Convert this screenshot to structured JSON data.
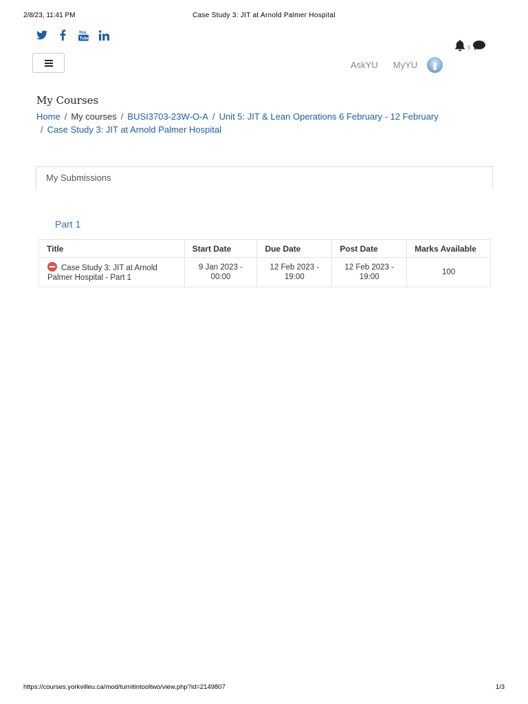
{
  "print_header": {
    "datetime": "2/8/23, 11:41 PM",
    "title": "Case Study 3: JIT at Arnold Palmer Hospital"
  },
  "social_icons": [
    "twitter-icon",
    "facebook-icon",
    "youtube-icon",
    "linkedin-icon"
  ],
  "menu": {
    "icon": "hamburger-menu-icon"
  },
  "notifications": {
    "icon": "bell-icon",
    "count": "5",
    "messages_icon": "chat-icon"
  },
  "top_nav": {
    "ask_label": "AskYU",
    "my_label": "MyYU"
  },
  "page_title": "My Courses",
  "breadcrumb": {
    "home": "Home",
    "my_courses": "My courses",
    "course": "BUSI3703-23W-O-A",
    "unit": "Unit 5: JIT & Lean Operations 6 February - 12 February",
    "current": "Case Study 3: JIT at Arnold Palmer Hospital",
    "separator": "/"
  },
  "tabs": {
    "submissions": "My Submissions"
  },
  "part": {
    "title": "Part 1"
  },
  "table": {
    "headers": {
      "title": "Title",
      "start": "Start Date",
      "due": "Due Date",
      "post": "Post Date",
      "marks": "Marks Available"
    },
    "rows": [
      {
        "status_icon": "stop-icon",
        "title": "Case Study 3: JIT at Arnold Palmer Hospital - Part 1",
        "start": "9 Jan 2023 - 00:00",
        "due": "12 Feb 2023 - 19:00",
        "post": "12 Feb 2023 - 19:00",
        "marks": "100"
      }
    ]
  },
  "print_footer": {
    "url": "https://courses.yorkvilleu.ca/mod/turnitintooltwo/view.php?id=2149807",
    "page": "1/3"
  },
  "colors": {
    "link": "#1a5ea8",
    "part_title": "#2f73b8",
    "stop": "#d9534f"
  }
}
